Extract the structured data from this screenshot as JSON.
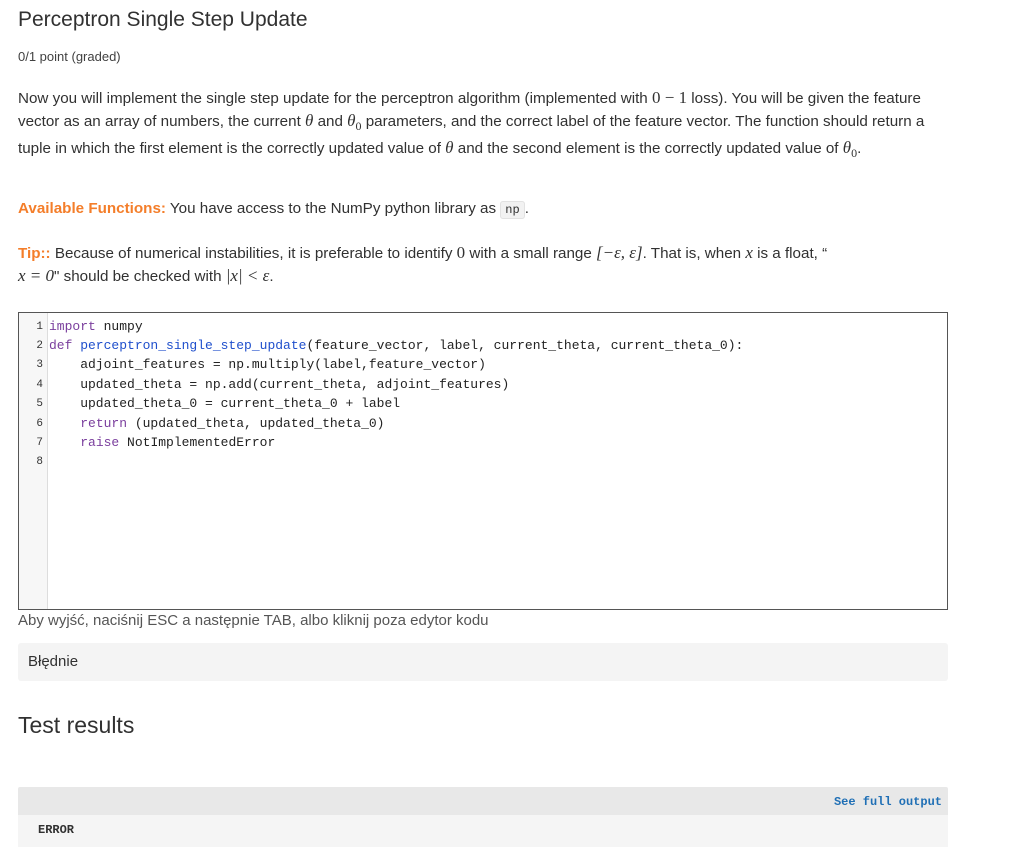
{
  "problem": {
    "title": "Perceptron Single Step Update",
    "points": "0/1 point (graded)"
  },
  "description": {
    "s1": "Now you will implement the single step update for the perceptron algorithm (implemented with ",
    "m_zero": "0",
    "m_minus": " − ",
    "m_one": "1",
    "s2": " loss). You will be given the feature vector as an array of numbers, the current ",
    "theta": "θ",
    "s3": " and ",
    "theta0": "θ",
    "sub0": "0",
    "s4": " parameters, and the correct label of the feature vector. The function should return a tuple in which the first element is the correctly updated value of ",
    "theta_b": "θ",
    "s5": " and the second element is the correctly updated value of ",
    "theta0_b": "θ",
    "sub0_b": "0",
    "s6": "."
  },
  "available": {
    "label": "Available Functions:",
    "text": " You have access to the NumPy python library as ",
    "code": "np",
    "end": "."
  },
  "tip": {
    "label": "Tip::",
    "s1": " Because of numerical instabilities, it is preferable to identify ",
    "zero": "0",
    "s2": " with a small range ",
    "range": "[−ε, ε]",
    "s3": ". That is, when ",
    "x": "x",
    "s4": " is a float, “",
    "eq": "x = 0",
    "s5": "\" should be checked with ",
    "abs": "|x| < ε",
    "s6": "."
  },
  "editor": {
    "line_numbers": [
      "1",
      "2",
      "3",
      "4",
      "5",
      "6",
      "7",
      "8"
    ],
    "l1_kw": "import",
    "l1_rest": " numpy",
    "l2_kw": "def",
    "l2_fn": " perceptron_single_step_update",
    "l2_rest": "(feature_vector, label, current_theta, current_theta_0):",
    "l3": "    adjoint_features = np.multiply(label,feature_vector)",
    "l4": "    updated_theta = np.add(current_theta, adjoint_features)",
    "l5": "    updated_theta_0 = current_theta_0 + label",
    "l6_indent": "    ",
    "l6_kw": "return",
    "l6_rest": " (updated_theta, updated_theta_0)",
    "l7_indent": "    ",
    "l7_kw": "raise",
    "l7_rest": " NotImplementedError"
  },
  "hint": "Aby wyjść, naciśnij ESC a następnie TAB, albo kliknij poza edytor kodu",
  "status": "Błędnie",
  "test_results": {
    "title": "Test results",
    "see_full": "See full output",
    "error": "ERROR"
  }
}
